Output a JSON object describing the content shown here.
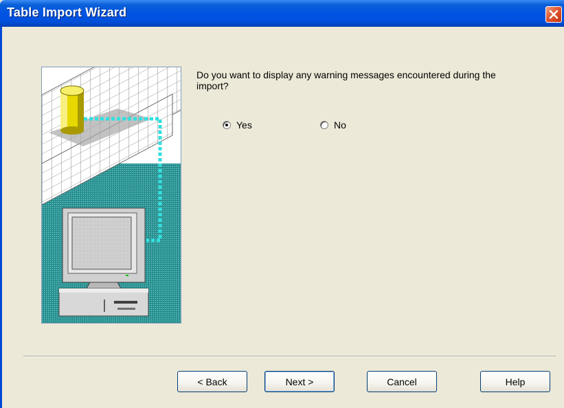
{
  "window": {
    "title": "Table Import Wizard"
  },
  "dialog": {
    "question": "Do you want to display any warning messages encountered during the import?",
    "options": [
      {
        "label": "Yes",
        "selected": true
      },
      {
        "label": "No",
        "selected": false
      }
    ]
  },
  "buttons": {
    "back": "< Back",
    "next": "Next >",
    "cancel": "Cancel",
    "help": "Help"
  },
  "icons": {
    "close": "close-icon",
    "illustration": "database-to-computer-illustration"
  },
  "colors": {
    "titlebar": "#0054e3",
    "close": "#e2572e",
    "dialog_bg": "#ece9d8",
    "cylinder": "#f0e000",
    "link": "#33e0e0",
    "floor": "#2a8a8a"
  }
}
